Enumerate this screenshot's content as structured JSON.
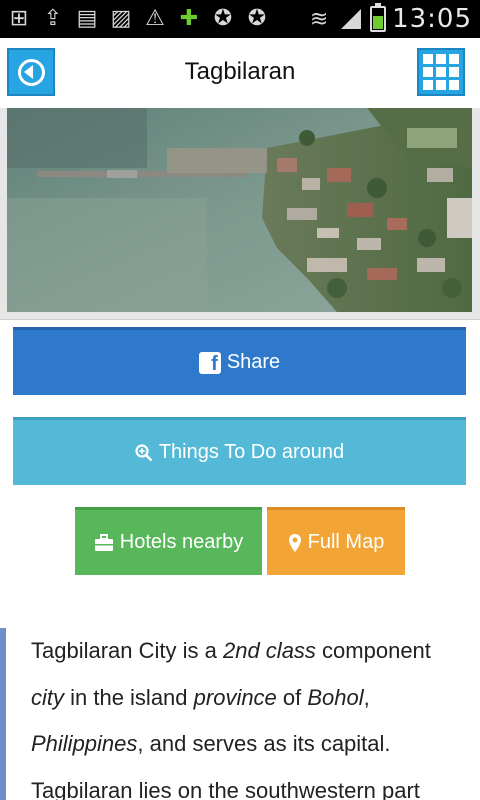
{
  "status_bar": {
    "time": "13:05",
    "icons": [
      "add-box-icon",
      "upload-icon",
      "sd-card-icon",
      "image-icon",
      "warning-icon",
      "plus-icon",
      "star-icon",
      "star-icon",
      "vibrate-icon",
      "signal-icon",
      "battery-icon"
    ],
    "battery_level": 0.6
  },
  "header": {
    "title": "Tagbilaran",
    "back_icon": "back-arrow-icon",
    "menu_icon": "grid-menu-icon"
  },
  "photo": {
    "description_icon": "aerial-photo"
  },
  "buttons": {
    "share": "Share",
    "things_to_do": "Things To Do around",
    "hotels": "Hotels nearby",
    "full_map": "Full Map"
  },
  "colors": {
    "share": "#2f79cd",
    "things_to_do": "#53b9d6",
    "hotels": "#58b75a",
    "full_map": "#f2a534",
    "header_buttons": "#27a4e2"
  },
  "article": {
    "l1_a": "Tagbilaran City is a ",
    "l1_b": "2nd class",
    "l1_c": " component",
    "l2_a": "city",
    "l2_b": " in the island ",
    "l2_c": "province",
    "l2_d": " of ",
    "l2_e": "Bohol",
    "l2_f": ",",
    "l3_a": "Philippines",
    "l3_b": ", and serves as its capital.",
    "l4": "Tagbilaran lies on the southwestern part"
  }
}
